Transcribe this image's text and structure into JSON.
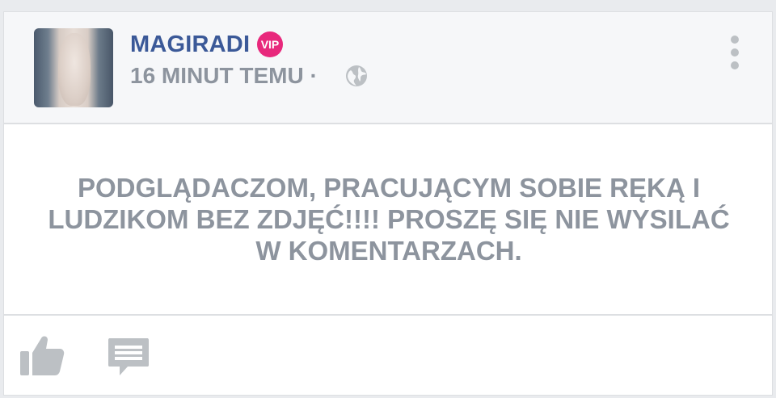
{
  "post": {
    "username": "MAGIRADI",
    "badge": "VIP",
    "time": "16 MINUT TEMU ·",
    "privacy_icon": "globe-icon",
    "menu_icon": "more-vertical-icon",
    "text": "PODGLĄDACZOM, PRACUJĄCYM SOBIE RĘKĄ I LUDZIKOM BEZ ZDJĘĆ!!!! PROSZĘ SIĘ NIE WYSILAĆ W KOMENTARZACH."
  },
  "actions": {
    "like_icon": "thumbs-up-icon",
    "comment_icon": "comment-icon"
  },
  "colors": {
    "username": "#3b5998",
    "vip_badge": "#e8287c",
    "muted_text": "#8d949e",
    "icon_gray": "#bcc0c4"
  }
}
